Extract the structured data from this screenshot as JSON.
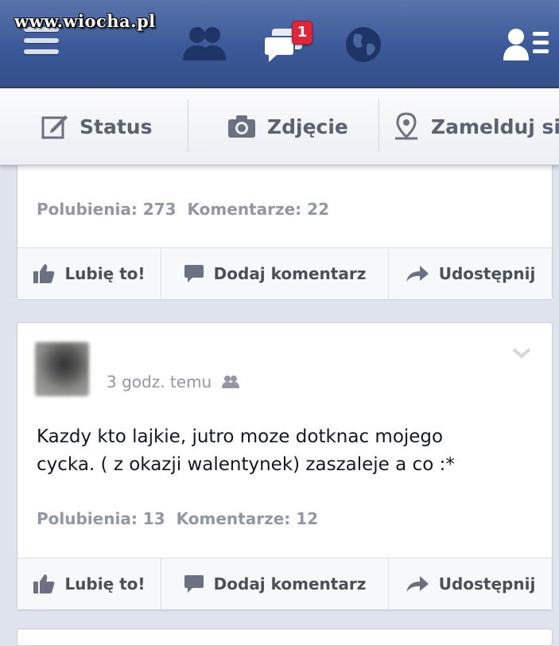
{
  "watermark": "www.wiocha.pl",
  "header": {
    "icons": [
      "menu-icon",
      "friends-icon",
      "messages-icon",
      "globe-icon",
      "friend-list-icon"
    ],
    "messages_badge": "1",
    "colors": {
      "bar": "#3b5998",
      "badge": "#e0263a"
    }
  },
  "composer": {
    "status": "Status",
    "photo": "Zdjęcie",
    "checkin": "Zamelduj się"
  },
  "posts": [
    {
      "likes": "Polubienia: 273",
      "comments": "Komentarze: 22",
      "actions": {
        "like": "Lubię to!",
        "comment": "Dodaj komentarz",
        "share": "Udostępnij"
      }
    },
    {
      "timestamp": "3 godz. temu",
      "text_lines": [
        "Kazdy kto lajkie, jutro moze dotknac mojego",
        "cycka. ( z okazji walentynek) zaszaleje a co :*"
      ],
      "likes": "Polubienia: 13",
      "comments": "Komentarze: 12",
      "actions": {
        "like": "Lubię to!",
        "comment": "Dodaj komentarz",
        "share": "Udostępnij"
      }
    }
  ]
}
